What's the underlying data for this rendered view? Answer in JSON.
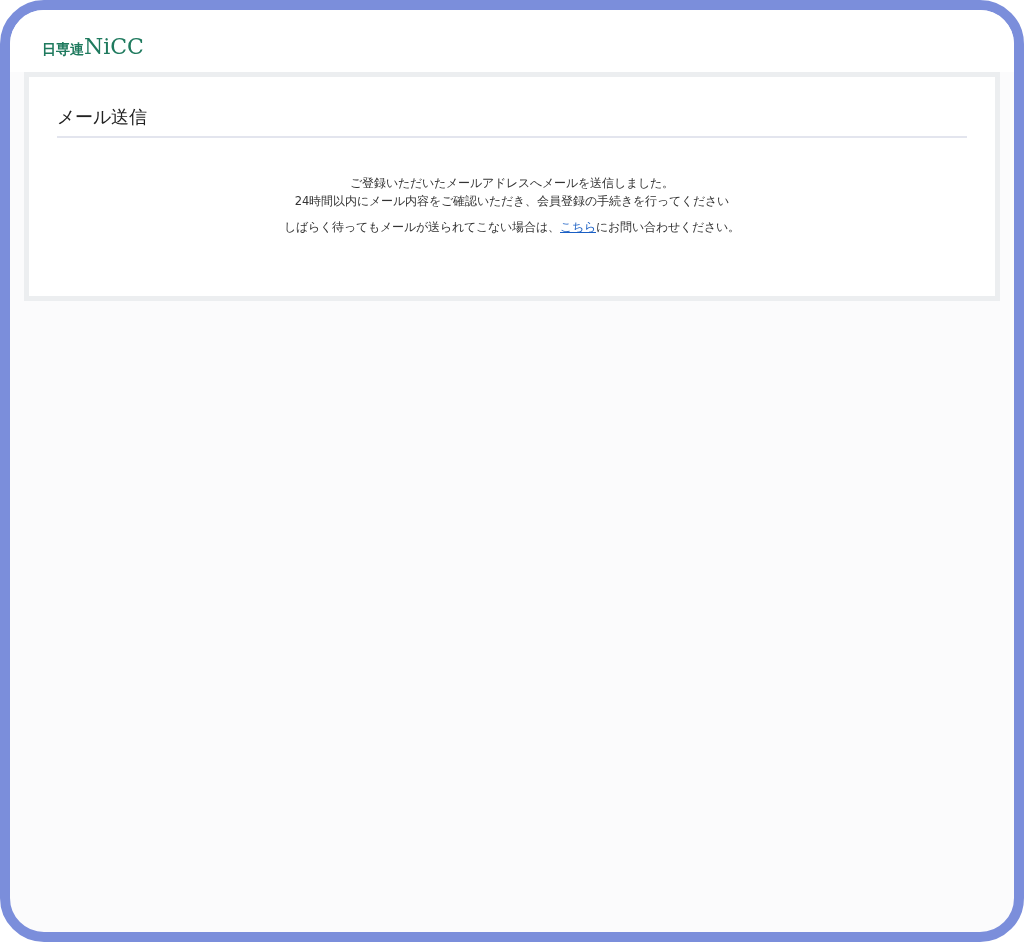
{
  "header": {
    "logo_kanji": "日専連",
    "logo_latin": "NiCC"
  },
  "card": {
    "title": "メール送信",
    "message_lines": [
      "ご登録いただいたメールアドレスへメールを送信しました。",
      "24時間以内にメール内容をご確認いただき、会員登録の手続きを行ってください"
    ],
    "contact": {
      "before": "しばらく待ってもメールが送られてこない場合は、",
      "link": "こちら",
      "after": "にお問い合わせください。"
    }
  }
}
